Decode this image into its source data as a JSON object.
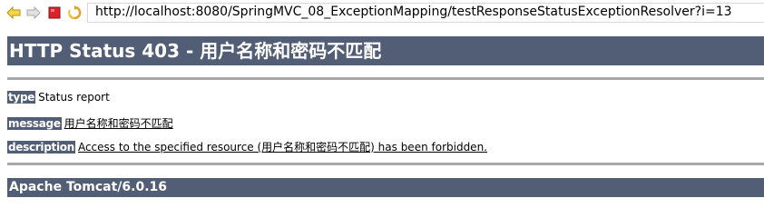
{
  "browser": {
    "url": "http://localhost:8080/SpringMVC_08_ExceptionMapping/testResponseStatusExceptionResolver?i=13",
    "icons": [
      "back-arrow-icon",
      "forward-arrow-icon",
      "stop-icon",
      "refresh-icon"
    ]
  },
  "page": {
    "title": "HTTP Status 403 - 用户名称和密码不匹配",
    "type_label": "type",
    "type_value": "Status report",
    "message_label": "message",
    "message_value": "用户名称和密码不匹配",
    "description_label": "description",
    "description_value": "Access to the specified resource (用户名称和密码不匹配) has been forbidden.",
    "footer": "Apache Tomcat/6.0.16"
  },
  "colors": {
    "header_bg": "#525d76",
    "rule": "#a8a8a8",
    "back_icon": "#e8c21a",
    "forward_icon": "#c8c8c8",
    "stop_icon": "#d8232a",
    "refresh_icon": "#e8a01a"
  }
}
